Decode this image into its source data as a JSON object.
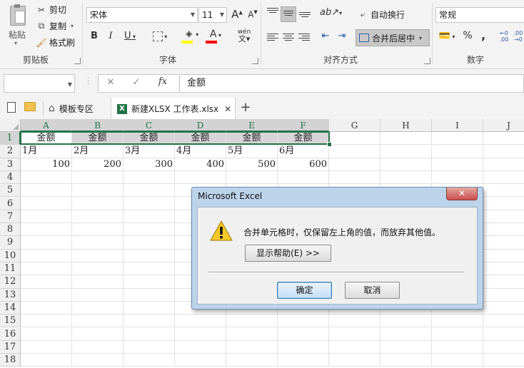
{
  "ribbon": {
    "clipboard": {
      "paste": "粘贴",
      "cut": "剪切",
      "copy": "复制",
      "format_painter": "格式刷",
      "group": "剪贴板"
    },
    "font": {
      "name": "宋体",
      "size": "11",
      "grow": "A",
      "shrink": "A",
      "bold": "B",
      "italic": "I",
      "underline": "U",
      "font_color": "A",
      "phonetic": "wén",
      "group": "字体"
    },
    "alignment": {
      "wrap": "自动换行",
      "merge_center": "合并后居中",
      "group": "对齐方式"
    },
    "number": {
      "format": "常规",
      "percent": "%",
      "comma": ",",
      "inc_decimal": "←0 .00",
      "dec_decimal": ".00 →0",
      "group": "数字"
    }
  },
  "formula_bar": {
    "name_box": "",
    "cancel": "✕",
    "enter": "✓",
    "fx": "fx",
    "content": "金额"
  },
  "tabs": {
    "template_tab": "模板专区",
    "file_tab": "新建XLSX 工作表.xlsx",
    "add": "+"
  },
  "sheet": {
    "columns": [
      "A",
      "B",
      "C",
      "D",
      "E",
      "F",
      "G",
      "H",
      "I",
      "J"
    ],
    "rows": [
      "1",
      "2",
      "3",
      "4",
      "5",
      "6",
      "7",
      "8",
      "9",
      "10",
      "11",
      "12",
      "13",
      "14",
      "15",
      "16",
      "17",
      "18"
    ],
    "row1": [
      "金额",
      "金额",
      "金额",
      "金额",
      "金额",
      "金额"
    ],
    "row2": [
      "1月",
      "2月",
      "3月",
      "4月",
      "5月",
      "6月"
    ],
    "row3": [
      "100",
      "200",
      "300",
      "400",
      "500",
      "600"
    ]
  },
  "dialog": {
    "title": "Microsoft Excel",
    "close": "✕",
    "message": "合并单元格时，仅保留左上角的值，而放弃其他值。",
    "help_button": "显示帮助(E) >>",
    "ok_button": "确定",
    "cancel_button": "取消"
  },
  "colors": {
    "excel_green": "#217346",
    "selection_gray": "#d6d6d6",
    "close_red": "#c75050"
  }
}
